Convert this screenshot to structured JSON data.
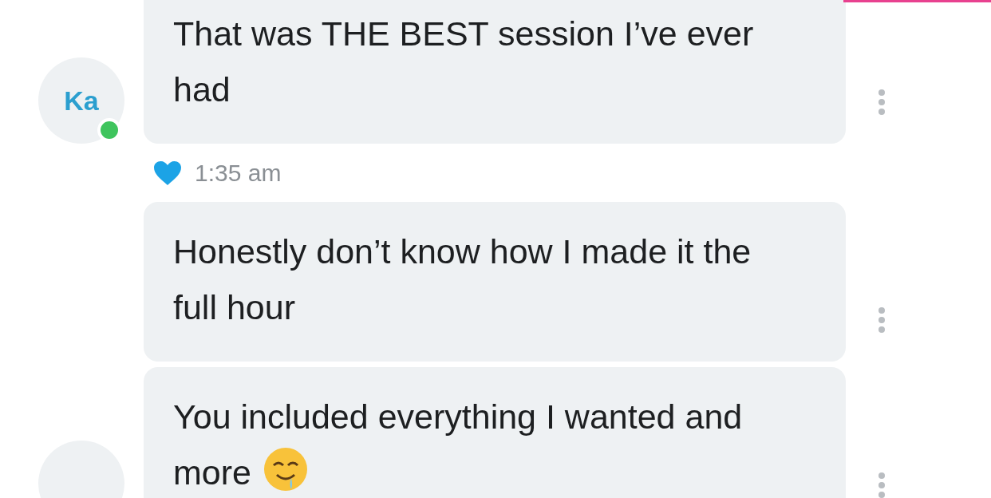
{
  "messages": [
    {
      "text": "That was THE BEST session I’ve ever had",
      "avatar": {
        "initials": "Ka",
        "online": true
      },
      "liked": true,
      "time": "1:35 am"
    },
    {
      "text": "Honestly don’t know how I made it the full hour"
    },
    {
      "text": "You included everything I wanted and more",
      "has_avatar": true,
      "drool_emoji": true
    }
  ]
}
